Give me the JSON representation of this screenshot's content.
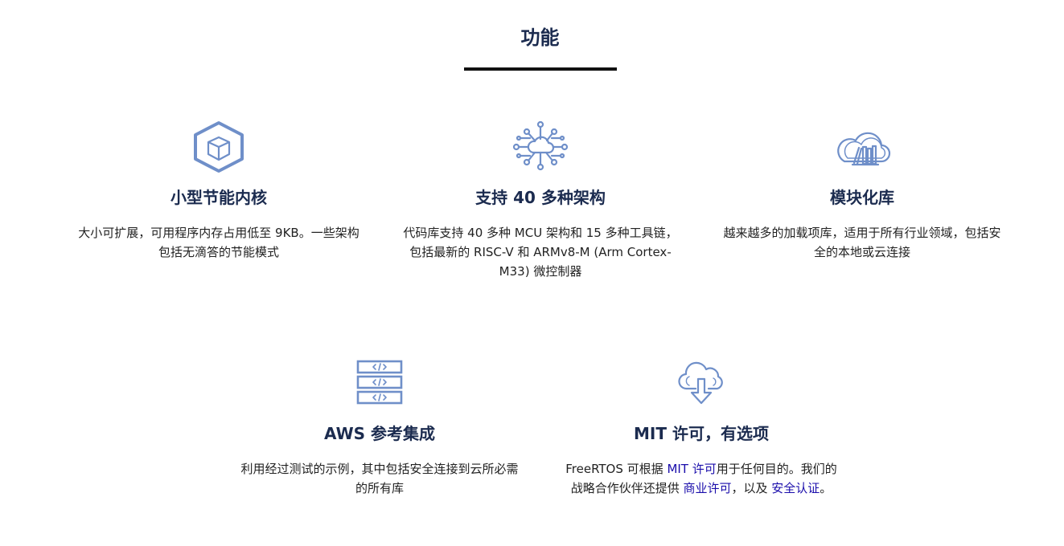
{
  "section": {
    "title": "功能"
  },
  "colors": {
    "heading": "#1b2b4f",
    "icon": "#6f8fc9",
    "link": "#1a0dab",
    "underline": "#111111"
  },
  "features": [
    {
      "icon": "cube-hexagon-icon",
      "title": "小型节能内核",
      "description": "大小可扩展，可用程序内存占用低至 9KB。一些架构包括无滴答的节能模式"
    },
    {
      "icon": "cloud-network-icon",
      "title": "支持 40 多种架构",
      "description": "代码库支持 40 多种 MCU 架构和 15 多种工具链，包括最新的 RISC-V 和 ARMv8-M (Arm Cortex-M33) 微控制器"
    },
    {
      "icon": "cloud-library-icon",
      "title": "模块化库",
      "description": "越来越多的加载项库，适用于所有行业领域，包括安全的本地或云连接"
    },
    {
      "icon": "code-stack-icon",
      "title": "AWS 参考集成",
      "description": "利用经过测试的示例，其中包括安全连接到云所必需的所有库"
    },
    {
      "icon": "cloud-download-icon",
      "title": "MIT 许可，有选项",
      "description_parts": {
        "before": "FreeRTOS 可根据 ",
        "link1": "MIT 许可",
        "middle1": "用于任何目的。我们的战略合作伙伴还提供 ",
        "link2": "商业许可",
        "middle2": "，以及 ",
        "link3": "安全认证",
        "after": "。"
      }
    }
  ]
}
